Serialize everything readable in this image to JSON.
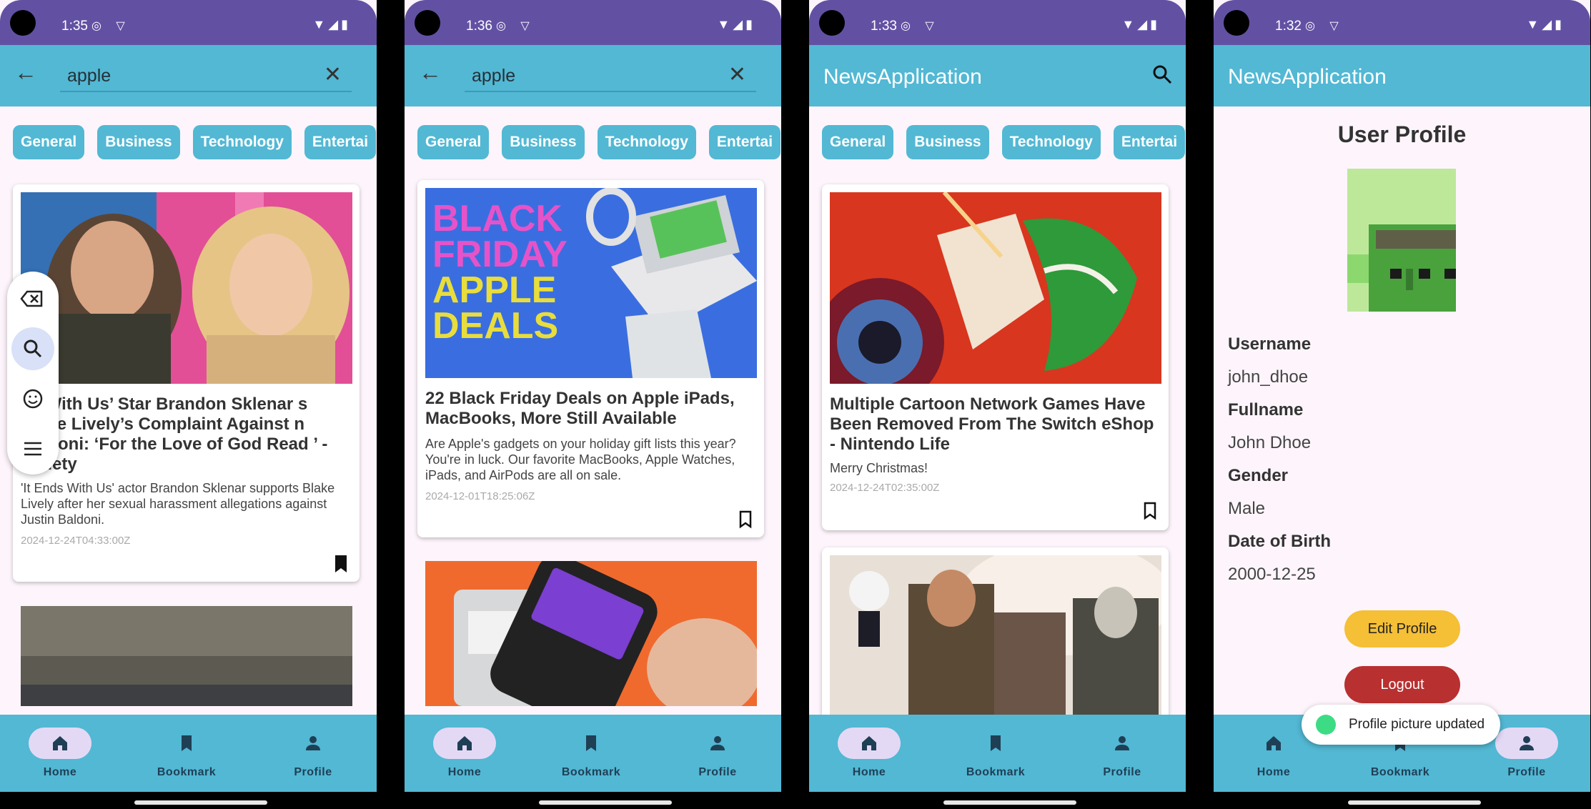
{
  "screens": [
    {
      "time": "1:35",
      "search": {
        "value": "apple"
      },
      "chips": [
        "General",
        "Business",
        "Technology",
        "Entertai"
      ],
      "article1": {
        "title": "ds With Us’ Star Brandon Sklenar s Blake Lively’s Complaint Against n Baldoni: ‘For the Love of God Read ’ - Variety",
        "desc": "'It Ends With Us' actor Brandon Sklenar supports Blake Lively after her sexual harassment allegations against Justin Baldoni.",
        "date": "2024-12-24T04:33:00Z"
      }
    },
    {
      "time": "1:36",
      "search": {
        "value": "apple"
      },
      "chips": [
        "General",
        "Business",
        "Technology",
        "Entertai"
      ],
      "article1": {
        "img_text": [
          "BLACK",
          "FRIDAY",
          "APPLE",
          "DEALS"
        ],
        "title": "22 Black Friday Deals on Apple iPads, MacBooks, More Still Available",
        "desc": "Are Apple's gadgets on your holiday gift lists this year? You're in luck. Our favorite MacBooks, Apple Watches, iPads, and AirPods are all on sale.",
        "date": "2024-12-01T18:25:06Z"
      }
    },
    {
      "time": "1:33",
      "app_title": "NewsApplication",
      "chips": [
        "General",
        "Business",
        "Technology",
        "Entertai"
      ],
      "article1": {
        "title": "Multiple Cartoon Network Games Have Been Removed From The Switch eShop - Nintendo Life",
        "desc": "Merry Christmas!",
        "date": "2024-12-24T02:35:00Z"
      }
    },
    {
      "time": "1:32",
      "app_title": "NewsApplication",
      "profile": {
        "heading": "User Profile",
        "username_label": "Username",
        "username": "john_dhoe",
        "fullname_label": "Fullname",
        "fullname": "John Dhoe",
        "gender_label": "Gender",
        "gender": "Male",
        "dob_label": "Date of Birth",
        "dob": "2000-12-25",
        "edit_button": "Edit Profile",
        "logout_button": "Logout"
      },
      "toast": "Profile picture updated"
    }
  ],
  "nav": {
    "home": "Home",
    "bookmark": "Bookmark",
    "profile": "Profile"
  },
  "colors": {
    "status_bar": "#6251a3",
    "app_bar": "#52b8d4",
    "accent_pill": "#e4d9f5",
    "edit": "#f5bf36",
    "logout": "#b8302f"
  }
}
